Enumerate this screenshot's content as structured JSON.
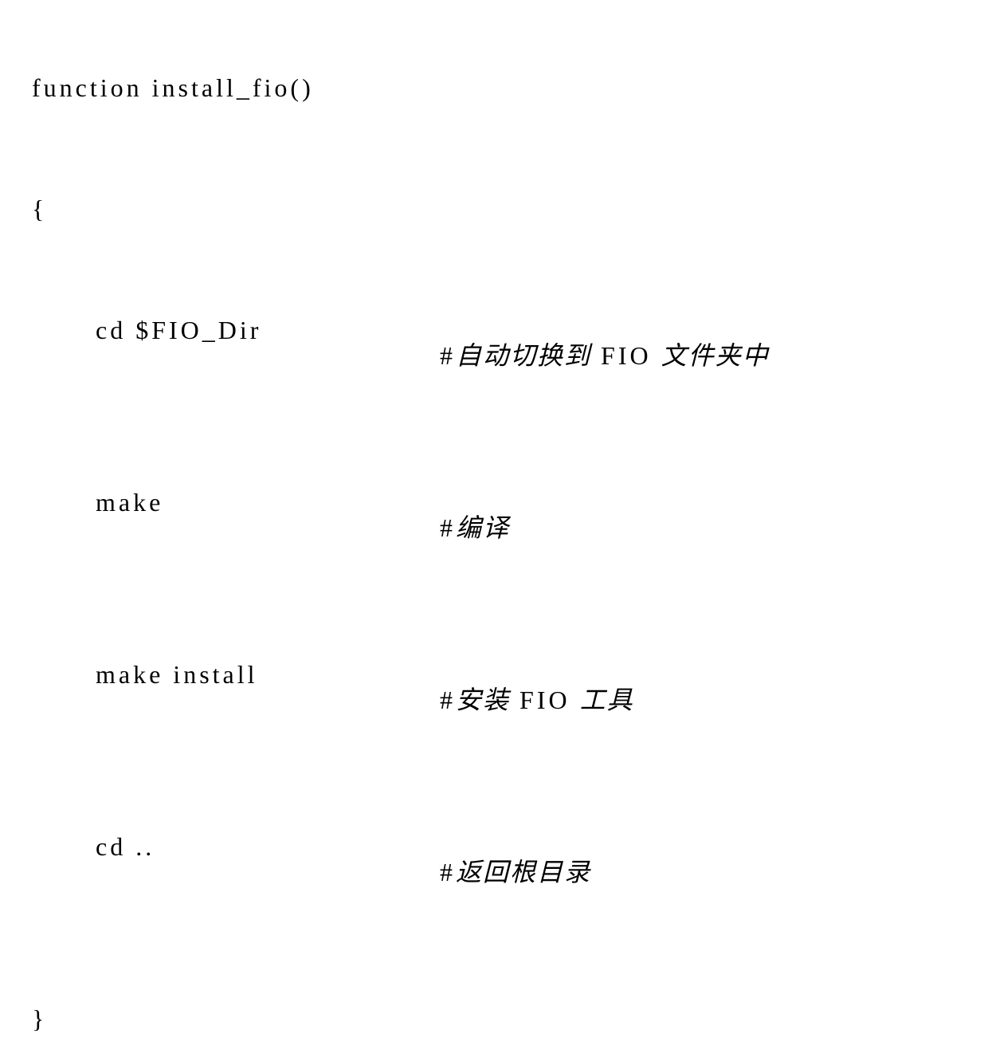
{
  "code": {
    "line1": "function install_fio()",
    "line2": "{",
    "line3": {
      "cmd": "cd $FIO_Dir",
      "comment_prefix": "#",
      "comment_cjk_1": "自动切换到",
      "comment_mid": " FIO ",
      "comment_cjk_2": "文件夹中"
    },
    "line4": {
      "cmd": "make",
      "comment_prefix": "#",
      "comment_cjk": "编译"
    },
    "line5": {
      "cmd": "make install",
      "comment_prefix": "#",
      "comment_cjk_1": "安装",
      "comment_mid": " FIO ",
      "comment_cjk_2": "工具"
    },
    "line6": {
      "cmd": "cd ..",
      "comment_prefix": "#",
      "comment_cjk": "返回根目录"
    },
    "line7": "}"
  }
}
